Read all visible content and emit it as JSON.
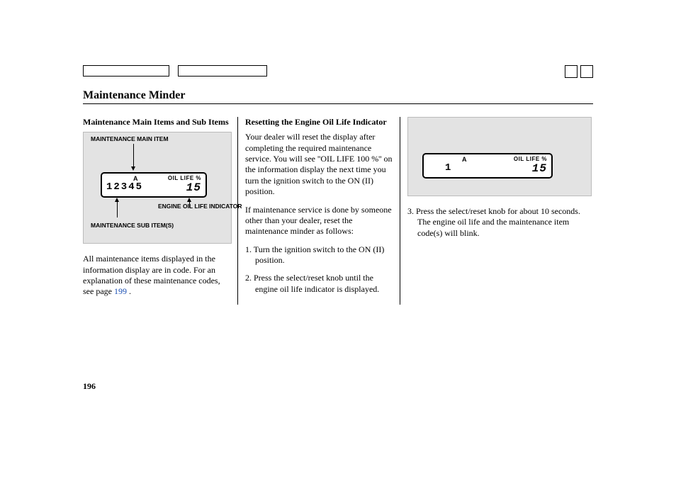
{
  "page_number": "196",
  "title": "Maintenance Minder",
  "col1": {
    "heading": "Maintenance Main Items and Sub Items",
    "diagram": {
      "main_item_label": "MAINTENANCE MAIN ITEM",
      "oil_life_label": "ENGINE OIL LIFE INDICATOR",
      "sub_item_label": "MAINTENANCE SUB ITEM(S)",
      "lcd": {
        "a": "A",
        "oil_text": "OIL LIFE %",
        "codes": "12345",
        "value": "15"
      }
    },
    "para1_a": "All maintenance items displayed in the information display are in code. For an explanation of these maintenance codes, see page ",
    "link": "199",
    "para1_b": " ."
  },
  "col2": {
    "heading": "Resetting the Engine Oil Life Indicator",
    "para1_a": "Your dealer will reset the display after completing the required maintenance service. You will see ''OIL LIFE 100 %'' on the information display the next time you turn the ignition switch to the ON (II) position.",
    "para2": "If maintenance service is done by someone other than your dealer, reset the maintenance minder as follows:",
    "step1_num": "1.",
    "step1": "Turn the ignition switch to the ON (II) position.",
    "step2_num": "2.",
    "step2": "Press the select/reset knob until the engine oil life indicator is displayed."
  },
  "col3": {
    "lcd": {
      "a": "A",
      "oil_text": "OIL LIFE %",
      "codes": "1",
      "value": "15"
    },
    "step3_num": "3.",
    "step3": "Press the select/reset knob for about 10 seconds. The engine oil life and the maintenance item code(s) will blink."
  }
}
